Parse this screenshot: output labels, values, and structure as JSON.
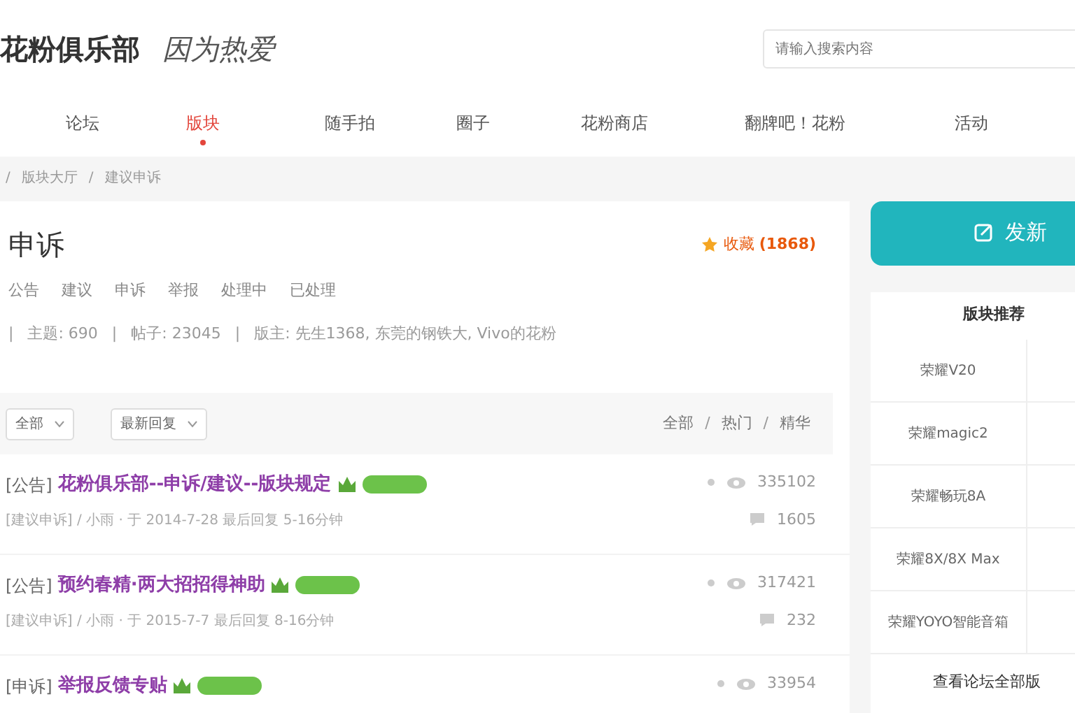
{
  "header": {
    "logo": "花粉俱乐部",
    "slogan": "因为热爱",
    "search": {
      "placeholder": "请输入搜索内容"
    }
  },
  "nav": [
    {
      "label": "论坛",
      "selected": false
    },
    {
      "label": "版块",
      "selected": true
    },
    {
      "label": "随手拍",
      "selected": false
    },
    {
      "label": "圈子",
      "selected": false
    },
    {
      "label": "花粉商店",
      "selected": false
    },
    {
      "label": "翻牌吧！花粉",
      "selected": false
    },
    {
      "label": "活动",
      "selected": false
    }
  ],
  "breadcrumb": {
    "separator": "/",
    "items": [
      "版块大厅",
      "建议申诉"
    ]
  },
  "forum": {
    "title": "申诉",
    "favorite": {
      "label": "收藏",
      "count": "(1868)"
    },
    "tags": [
      "公告",
      "建议",
      "申诉",
      "举报",
      "处理中",
      "已处理"
    ],
    "stat_separator": "|",
    "stats": [
      "主题: 690",
      "帖子: 23045",
      "版主: 先生1368, 东莞的钢铁大, Vivo的花粉"
    ]
  },
  "filters": {
    "selects": [
      "全部",
      "最新回复"
    ],
    "link_separator": "/",
    "links": [
      "全部",
      "热门",
      "精华"
    ]
  },
  "posts": [
    {
      "category": "[公告]",
      "title": "花粉俱乐部--申诉/建议--版块规定",
      "meta": "[建议申诉] / 小雨 · 于 2014-7-28 最后回复 5-16分钟",
      "views": "335102",
      "replies": "1605"
    },
    {
      "category": "[公告]",
      "title": "预约春精·两大招招得神助",
      "meta": "[建议申诉] / 小雨 · 于 2015-7-7 最后回复 8-16分钟",
      "views": "317421",
      "replies": "232"
    },
    {
      "category": "[申诉]",
      "title": "举报反馈专贴",
      "views": "33954"
    }
  ],
  "new_post_button": "发新",
  "recommend": {
    "title": "版块推荐",
    "items": [
      "荣耀V20",
      "荣耀magic2",
      "荣耀畅玩8A",
      "荣耀8X/8X Max",
      "荣耀YOYO智能音箱"
    ],
    "footer": "查看论坛全部版"
  }
}
